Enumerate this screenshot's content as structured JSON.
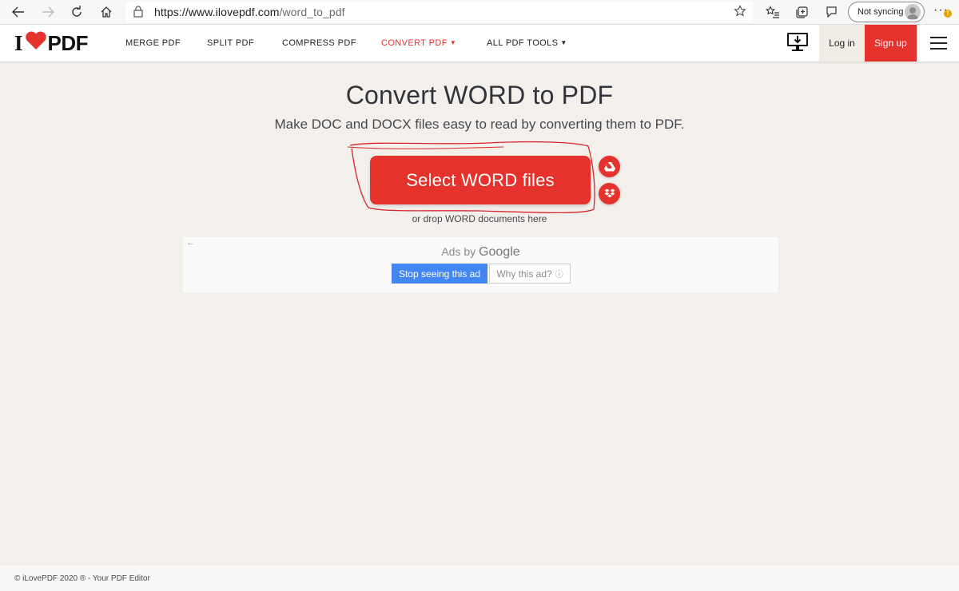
{
  "browser": {
    "url_host": "https://www.ilovepdf.com",
    "url_path": "/word_to_pdf",
    "profile_label": "Not syncing",
    "more_label": "···",
    "notification_badge": "!"
  },
  "header": {
    "logo_prefix": "I",
    "logo_suffix": "PDF",
    "nav": [
      {
        "label": "MERGE PDF"
      },
      {
        "label": "SPLIT PDF"
      },
      {
        "label": "COMPRESS PDF"
      },
      {
        "label": "CONVERT PDF"
      },
      {
        "label": "ALL PDF TOOLS"
      }
    ],
    "caret": "▼",
    "login": "Log in",
    "signup": "Sign up"
  },
  "main": {
    "title": "Convert WORD to PDF",
    "subtitle": "Make DOC and DOCX files easy to read by converting them to PDF.",
    "select_button": "Select WORD files",
    "drop_hint": "or drop WORD documents here"
  },
  "ad": {
    "ads_by": "Ads by",
    "google": "Google",
    "stop_button": "Stop seeing this ad",
    "why_button": "Why this ad?",
    "back_arrow": "←",
    "info_glyph": "ⓘ"
  },
  "footer": {
    "text": "© iLovePDF 2020 ® - Your PDF Editor"
  },
  "colors": {
    "brand_red": "#e5322d",
    "page_bg": "#f3f0ec",
    "google_blue": "#4285f4"
  },
  "icons": [
    "back-arrow-icon",
    "forward-arrow-icon",
    "refresh-icon",
    "home-icon",
    "lock-icon",
    "favorite-star-icon",
    "favorites-list-icon",
    "collections-icon",
    "feedback-icon",
    "desktop-download-icon",
    "google-drive-icon",
    "dropbox-icon",
    "hamburger-menu-icon"
  ]
}
